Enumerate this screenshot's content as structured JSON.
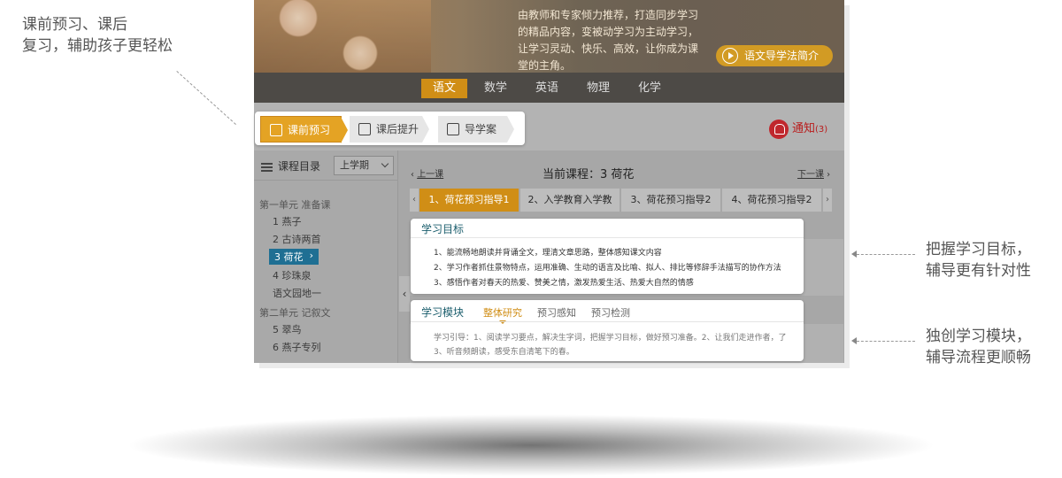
{
  "captions": {
    "left_line1": "课前预习、课后",
    "left_line2": "复习，辅助孩子更轻松",
    "right1_line1": "把握学习目标，",
    "right1_line2": "辅导更有针对性",
    "right2_line1": "独创学习模块，",
    "right2_line2": "辅导流程更顺畅"
  },
  "banner": {
    "text": "由教师和专家倾力推荐，打造同步学习的精品内容，变被动学习为主动学习，让学习灵动、快乐、高效，让你成为课堂的主角。",
    "intro_button": "语文导学法简介"
  },
  "subjects": [
    "语文",
    "数学",
    "英语",
    "物理",
    "化学"
  ],
  "mode_tabs": [
    "课前预习",
    "课后提升",
    "导学案"
  ],
  "notify": {
    "label": "通知",
    "count": "(3)"
  },
  "sidebar": {
    "title": "课程目录",
    "term": "上学期",
    "unit1": "第一单元 准备课",
    "lessons1": [
      "1 燕子",
      "2 古诗两首",
      "3 荷花",
      "4 珍珠泉",
      "语文园地一"
    ],
    "unit2": "第二单元 记叙文",
    "lessons2": [
      "5 翠鸟",
      "6 燕子专列"
    ]
  },
  "course": {
    "prev": "上一课",
    "current": "当前课程：3 荷花",
    "next": "下一课",
    "chips": [
      "1、荷花预习指导1",
      "2、入学教育入学教",
      "3、荷花预习指导2",
      "4、荷花预习指导2"
    ]
  },
  "goals": {
    "title": "学习目标",
    "items": [
      "1、能流畅地朗读并背诵全文，理清文章思路，整体感知课文内容",
      "2、学习作者抓住景物特点，运用准确、生动的语言及比喻、拟人、排比等修辞手法描写的协作方法",
      "3、感悟作者对春天的热爱、赞美之情，激发热爱生活、热爱大自然的情感"
    ]
  },
  "module": {
    "title": "学习模块",
    "tabs": [
      "整体研究",
      "预习感知",
      "预习检测"
    ],
    "guide_line1": "学习引导：1、阅读学习要点，解决生字词，把握学习目标，做好预习准备。2、让我们走进作者，了",
    "guide_line2": "3、听音频朗读，感受东自清笔下的春。"
  },
  "colors": {
    "accent": "#d08e16",
    "notify_red": "#c0272d",
    "active_lesson": "#1f6f93",
    "title_teal": "#1b5e6d"
  }
}
